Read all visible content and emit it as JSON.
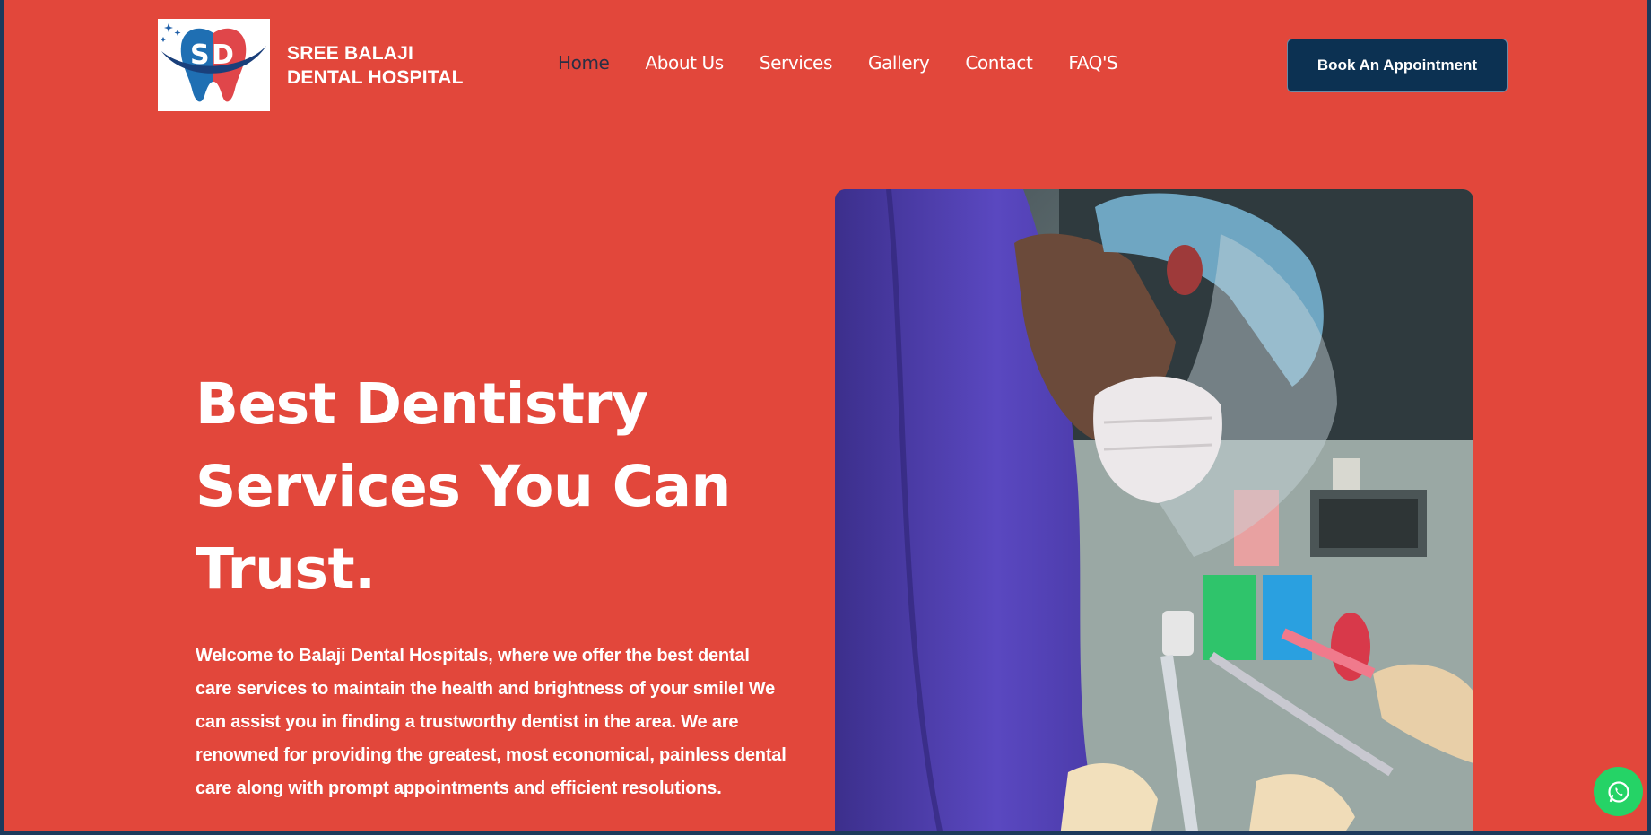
{
  "brand": {
    "line1": "SREE BALAJI",
    "line2": "DENTAL HOSPITAL",
    "logo_icon": "tooth-logo-icon",
    "colors": {
      "red": "#e2473b",
      "blue": "#1f5fa8"
    }
  },
  "nav": {
    "items": [
      {
        "label": "Home",
        "active": true
      },
      {
        "label": "About Us"
      },
      {
        "label": "Services"
      },
      {
        "label": "Gallery"
      },
      {
        "label": "Contact"
      },
      {
        "label": "FAQ'S"
      }
    ]
  },
  "cta": {
    "label": "Book An Appointment"
  },
  "hero": {
    "title": "Best Dentistry Services You Can Trust.",
    "description": "Welcome to Balaji Dental Hospitals, where we offer the best dental care services to maintain the health and brightness of your smile! We can assist you in finding a trustworthy dentist in the area. We are renowned for providing the greatest, most economical, painless dental care along with prompt appointments and efficient resolutions.",
    "image_icon": "dentist-photo"
  },
  "whatsapp": {
    "icon": "whatsapp-icon"
  },
  "theme": {
    "background": "#e2473b",
    "cta_bg": "#0c3152",
    "text": "#ffffff",
    "active_nav": "#2a2f44",
    "whatsapp": "#25d366"
  }
}
